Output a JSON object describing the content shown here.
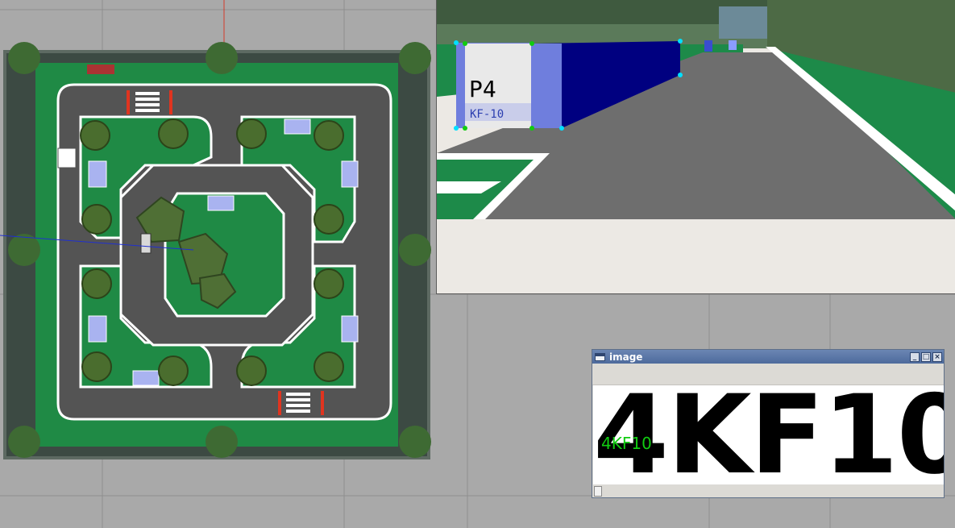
{
  "camera_view": {
    "sign_parking_label": "P4",
    "sign_plate_label": "KF-10"
  },
  "image_window": {
    "title": "image",
    "minimize_symbol": "_",
    "maximize_symbol": "□",
    "close_symbol": "×",
    "plate_text": "4KF10",
    "predicted_text": "4KF10"
  },
  "colors": {
    "grass": "#1f8a45",
    "road": "#545454",
    "lane_line": "#ffffff",
    "sign_blue": "#00008b",
    "detection_green": "#11cc11"
  },
  "icons": [
    "window-icon",
    "minimize-icon",
    "maximize-icon",
    "close-icon"
  ]
}
